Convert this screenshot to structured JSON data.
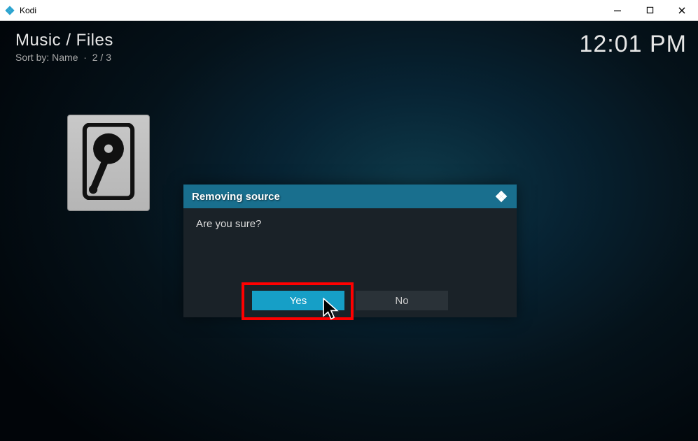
{
  "window": {
    "title": "Kodi"
  },
  "header": {
    "breadcrumb": "Music / Files",
    "sort_prefix": "Sort by:",
    "sort_value": "Name",
    "sort_sep": "·",
    "page": "2 / 3"
  },
  "clock": "12:01 PM",
  "dialog": {
    "title": "Removing source",
    "message": "Are you sure?",
    "yes_label": "Yes",
    "no_label": "No"
  },
  "icons": {
    "app_icon": "kodi-logo-icon",
    "drive": "hard-drive-icon",
    "dialog_logo": "kodi-logo-icon"
  }
}
